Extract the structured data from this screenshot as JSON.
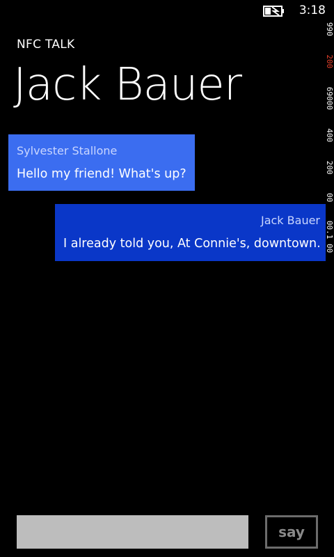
{
  "status_bar": {
    "time": "3:18",
    "battery_icon": "battery-charging-icon"
  },
  "app": {
    "title": "NFC TALK",
    "page_title": "Jack Bauer"
  },
  "messages": [
    {
      "sender": "Sylvester Stallone",
      "text": "Hello my friend! What's up?",
      "direction": "incoming",
      "color": "#3b6df0"
    },
    {
      "sender": "Jack Bauer",
      "text": "I already told you, At Connie's, downtown.",
      "direction": "outgoing",
      "color": "#0a37c8"
    }
  ],
  "debug_counters": {
    "values": [
      "990",
      "200",
      "69000",
      "400",
      "200",
      "00",
      "00.1",
      "00"
    ],
    "highlight_color": "#e8412b"
  },
  "composer": {
    "input_value": "",
    "say_label": "say"
  }
}
